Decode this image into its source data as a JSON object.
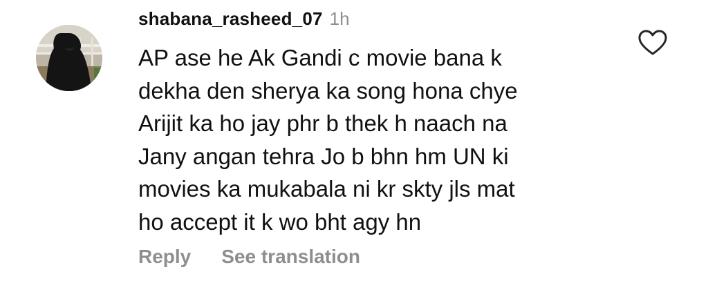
{
  "comment": {
    "username": "shabana_rasheed_07",
    "timestamp": "1h",
    "text_lines": [
      "AP ase he Ak Gandi c movie bana k",
      "dekha den sherya ka song hona chye",
      "Arijit ka ho jay phr b thek h naach na",
      "Jany angan tehra Jo b bhn hm UN ki",
      "movies ka mukabala ni kr skty jls mat",
      "ho accept it k wo bht agy hn"
    ],
    "actions": {
      "reply_label": "Reply",
      "translate_label": "See translation"
    },
    "icons": {
      "like": "heart-outline-icon",
      "avatar": "user-avatar"
    },
    "colors": {
      "primary_text": "#111111",
      "secondary_text": "#8e8e8e"
    }
  }
}
